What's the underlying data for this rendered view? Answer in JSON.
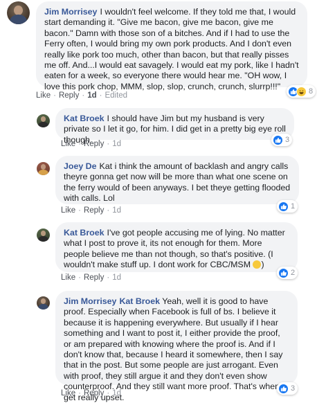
{
  "actions": {
    "like": "Like",
    "reply": "Reply",
    "dot": "·",
    "edited": "Edited"
  },
  "icons": {
    "like_reaction": "thumbs-up-icon",
    "haha_reaction": "laughing-emoji-icon",
    "inline_emoji": "rofl-emoji-icon"
  },
  "colors": {
    "author": "#385898",
    "bubble": "#f2f3f5",
    "like_blue": "#1877f2",
    "haha_yellow": "#f7c93c"
  },
  "comments": [
    {
      "author": "Jim Morrisey",
      "text": "I wouldn't feel welcome. If they told me that, I would start demanding it. \"Give me bacon, give me bacon, give me bacon.\" Damn with those son of a bitches. And if I had to use the Ferry often, I would bring my own pork products. And I don't even really like pork too much, other than bacon, but that really pisses me off. And...I would eat savagely. I would eat my pork, like I hadn't eaten for a week, so everyone there would hear me. \"OH wow, I love this pork chop, MMM, slop, slop, crunch, crunch, slurrp!!!\"",
      "time": "1d",
      "reactions": "8"
    },
    {
      "author": "Kat Broek",
      "text": "I should have Jim but my husband is very private so I let it go, for him. I did get in a pretty big eye roll though.",
      "time": "1d",
      "reactions": "3"
    },
    {
      "author": "Joey De",
      "text": "Kat i think the amount of backlash and angry calls theyre gonna get now will be more than what one scene on the ferry would of been anyways. I bet theye getting flooded with calls. Lol",
      "time": "1d",
      "reactions": "1"
    },
    {
      "author": "Kat Broek",
      "text": "I've got people accusing me of lying. No matter what I post to prove it, its not enough for them. More people believe me than not though, so that's positive. (I wouldn't make stuff up. I dont work for CBC/MSM",
      "time": "1d",
      "reactions": "2"
    },
    {
      "author": "Jim Morrisey",
      "mention": "Kat Broek",
      "text": "Yeah, well it is good to have proof. Especially when Facebook is full of bs. I believe it because it is happening everywhere. But usually if I hear something and I want to post it, I either provide the proof, or am prepared with knowing where the proof is. And if I don't know that, because I heard it somewhere, then I say that in the post. But some people are just arrogant. Even with proof, they still argue it and they don't even show counterproof. And they still want more proof. That's when I get really upset.",
      "time": "1d",
      "reactions": "3"
    }
  ]
}
